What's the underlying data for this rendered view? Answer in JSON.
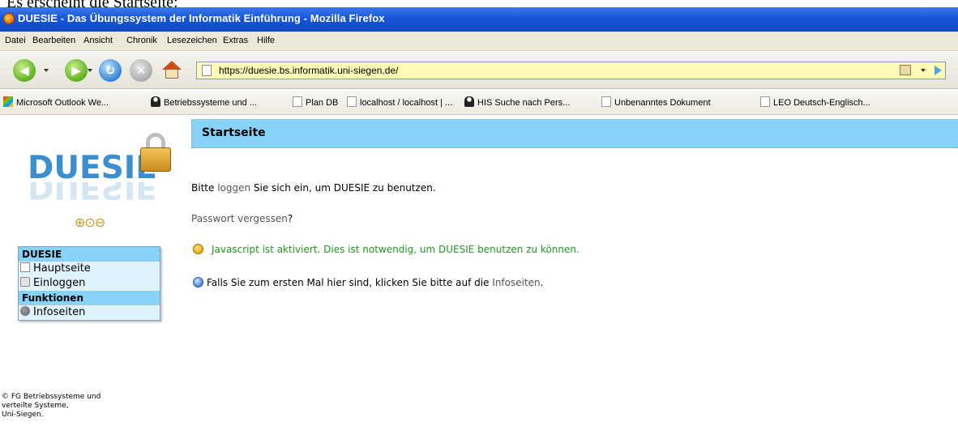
{
  "caption": "Es erscheint die Startseite:",
  "window": {
    "title": "DUESIE - Das Übungssystem der Informatik Einführung - Mozilla Firefox"
  },
  "menu": [
    "Datei",
    "Bearbeiten",
    "Ansicht",
    "Chronik",
    "Lesezeichen",
    "Extras",
    "Hilfe"
  ],
  "address_bar": {
    "url": "https://duesie.bs.informatik.uni-siegen.de/"
  },
  "bookmarks": [
    {
      "label": "Microsoft Outlook We...",
      "icon": "outlook-icon"
    },
    {
      "label": "Betriebssysteme und ...",
      "icon": "tux-icon"
    },
    {
      "label": "Plan DB",
      "icon": "page-icon"
    },
    {
      "label": "localhost / localhost | ...",
      "icon": "page-icon"
    },
    {
      "label": "HIS Suche nach Pers...",
      "icon": "tux-icon"
    },
    {
      "label": "Unbenanntes Dokument",
      "icon": "page-icon"
    },
    {
      "label": "LEO Deutsch-Englisch...",
      "icon": "page-icon"
    }
  ],
  "page": {
    "header_title": "Startseite",
    "logo_text": "DUESIE",
    "nav": {
      "section1_title": "DUESIE",
      "items1": [
        {
          "label": "Hauptseite",
          "icon": "page-icon"
        },
        {
          "label": "Einloggen",
          "icon": "lock-icon"
        }
      ],
      "section2_title": "Funktionen",
      "items2": [
        {
          "label": "Infoseiten",
          "icon": "info-icon"
        }
      ]
    },
    "login_prefix": "Bitte ",
    "login_link": "loggen",
    "login_suffix": " Sie sich ein, um DUESIE zu benutzen.",
    "password_link": "Passwort vergessen",
    "password_suffix": "?",
    "js_message": "Javascript ist aktiviert. Dies ist notwendig, um DUESIE benutzen zu können.",
    "info_prefix": "Falls Sie zum ersten Mal hier sind, klicken Sie bitte auf die ",
    "info_link": "Infoseiten",
    "info_suffix": ".",
    "footer": [
      "© FG Betriebssysteme und",
      "verteilte Systeme,",
      "Uni-Siegen."
    ]
  }
}
